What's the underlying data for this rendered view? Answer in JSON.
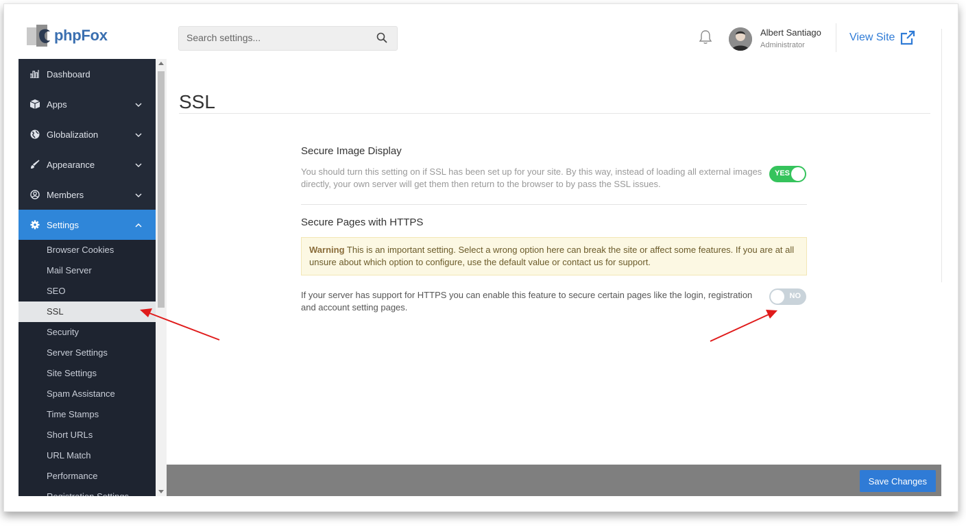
{
  "brand": {
    "logo_text": "phpFox",
    "logo_icon": "phpfox-logo-icon"
  },
  "header": {
    "search_placeholder": "Search settings...",
    "user_name": "Albert Santiago",
    "user_role": "Administrator",
    "view_site_label": "View Site"
  },
  "sidebar": {
    "items": [
      {
        "label": "Dashboard",
        "icon": "bar-chart-icon"
      },
      {
        "label": "Apps",
        "icon": "cube-icon"
      },
      {
        "label": "Globalization",
        "icon": "globe-icon"
      },
      {
        "label": "Appearance",
        "icon": "brush-icon"
      },
      {
        "label": "Members",
        "icon": "user-circle-icon"
      },
      {
        "label": "Settings",
        "icon": "gear-icon"
      }
    ],
    "sub_items": [
      "Browser Cookies",
      "Mail Server",
      "SEO",
      "SSL",
      "Security",
      "Server Settings",
      "Site Settings",
      "Spam Assistance",
      "Time Stamps",
      "Short URLs",
      "URL Match",
      "Performance",
      "Registration Settings"
    ],
    "current_sub_item": "SSL"
  },
  "page": {
    "title": "SSL"
  },
  "settings": [
    {
      "title": "Secure Image Display",
      "description": "You should turn this setting on if SSL has been set up for your site. By this way, instead of loading all external images directly, your own server will get them then return to the browser to by pass the SSL issues.",
      "toggle_label": "YES",
      "enabled": true
    },
    {
      "title": "Secure Pages with HTTPS",
      "warning_bold": "Warning",
      "warning_text": " This is an important setting. Select a wrong option here can break the site or affect some features. If you are at all unsure about which option to configure, use the default value or contact us for support.",
      "description": "If your server has support for HTTPS you can enable this feature to secure certain pages like the login, registration and account setting pages.",
      "toggle_label": "NO",
      "enabled": false
    }
  ],
  "footer": {
    "save_label": "Save Changes"
  },
  "colors": {
    "accent": "#2f7bd6",
    "sidebar_bg": "#232a37",
    "toggle_on": "#35c35c",
    "toggle_off": "#c9d3da",
    "annotation_arrow": "#e01b1b"
  }
}
